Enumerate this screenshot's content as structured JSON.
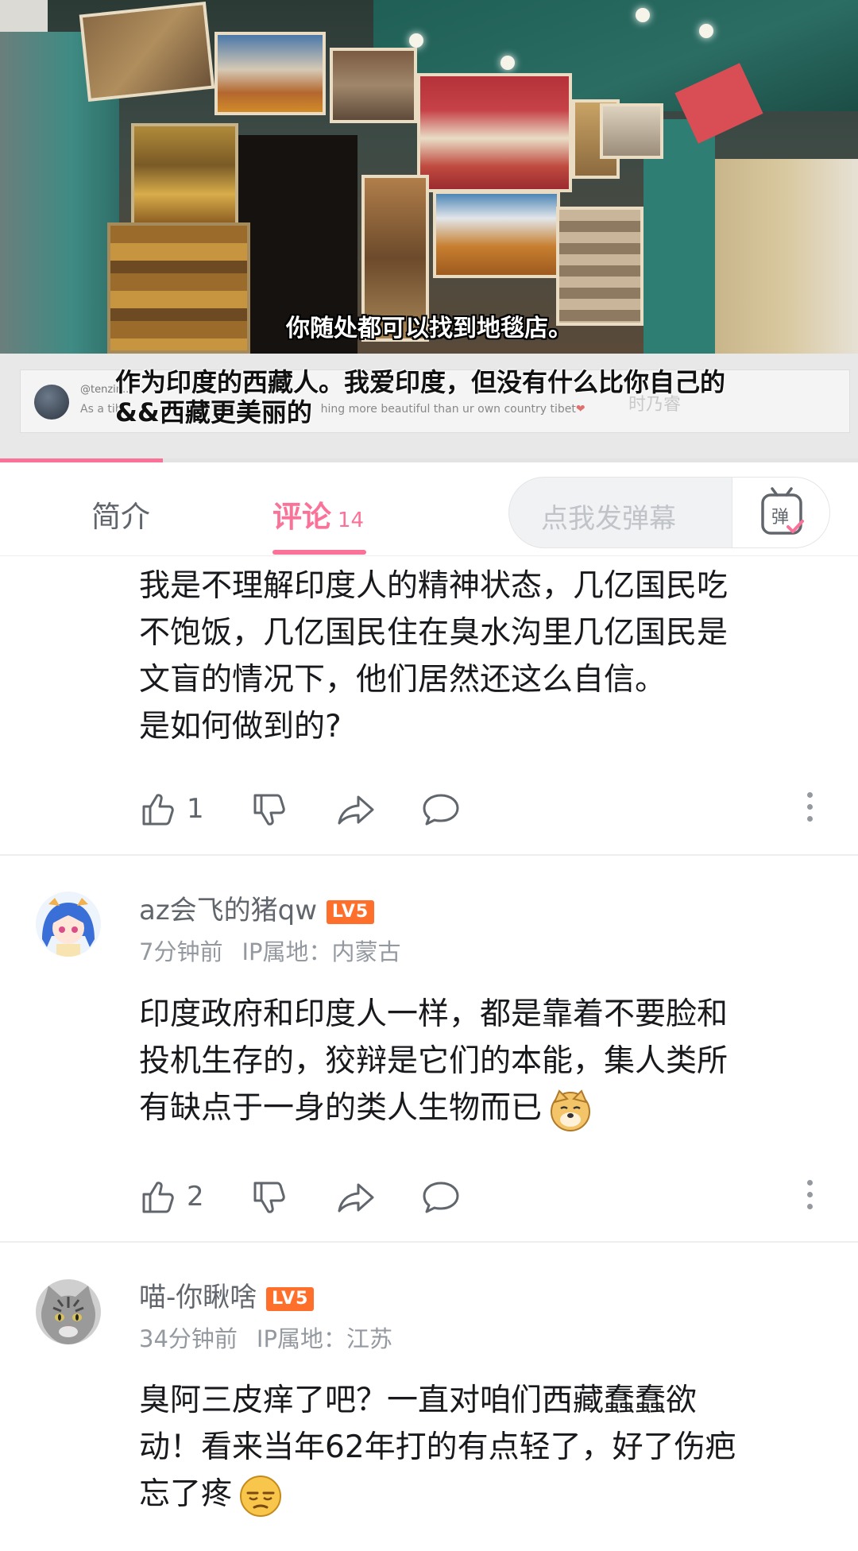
{
  "video": {
    "subtitle": "你随处都可以找到地毯店。"
  },
  "overlay": {
    "tweet_handle": "@tenzin...",
    "tweet_text_start": "As a tib",
    "tweet_text_end": "hing more beautiful than ur own country tibet",
    "caption_line1": "作为印度的西藏人。我爱印度，但没有什么比你自己的",
    "caption_line2": "&&西藏更美丽的",
    "ghost_text": "时乃睿",
    "progress_fraction": 0.19
  },
  "tabs": {
    "intro_label": "简介",
    "comments_label": "评论",
    "comments_count": "14",
    "danmaku_placeholder": "点我发弹幕",
    "danmaku_icon_text": "弹"
  },
  "comments": [
    {
      "lines": [
        "我是不理解印度人的精神状态，几亿国民吃",
        "不饱饭，几亿国民住在臭水沟里几亿国民是",
        "文盲的情况下，他们居然还这么自信。",
        "是如何做到的?"
      ],
      "likes": "1"
    },
    {
      "username": "az会飞的猪qw",
      "level": "LV5",
      "time": "7分钟前",
      "ip": "IP属地：内蒙古",
      "lines": [
        "印度政府和印度人一样，都是靠着不要脸和",
        "投机生存的，狡辩是它们的本能，集人类所",
        "有缺点于一身的类人生物而已"
      ],
      "likes": "2",
      "emoji": "doge-emoji"
    },
    {
      "username": "喵-你瞅啥",
      "level": "LV5",
      "time": "34分钟前",
      "ip": "IP属地：江苏",
      "lines": [
        "臭阿三皮痒了吧？一直对咱们西藏蠢蠢欲",
        "动！看来当年62年打的有点轻了，好了伤疤",
        "忘了疼"
      ],
      "emoji": "sleepy-face-emoji"
    }
  ],
  "colors": {
    "accent_pink": "#fb7299",
    "level_orange": "#ff6f2c",
    "text_gray": "#61666d",
    "meta_gray": "#9499a0"
  }
}
